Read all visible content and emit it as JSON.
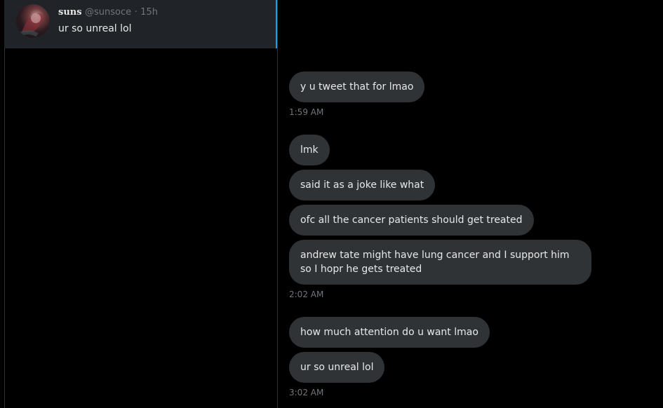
{
  "conversation": {
    "name": "suns",
    "handle": "@sunsoce",
    "separator": "·",
    "time": "15h",
    "preview": "ur so unreal lol"
  },
  "messages": [
    {
      "text": "y u tweet that for lmao"
    },
    {
      "text": "lmk"
    },
    {
      "text": "said it as a joke like what"
    },
    {
      "text": "ofc all the cancer patients should get treated"
    },
    {
      "text": "andrew tate might have lung cancer and I support him so I hopr he gets treated"
    },
    {
      "text": "how much attention do u want lmao"
    },
    {
      "text": "ur so unreal lol"
    }
  ],
  "timestamps": [
    "1:59 AM",
    "2:02 AM",
    "3:02 AM"
  ],
  "colors": {
    "background": "#000000",
    "selected_conversation": "#202327",
    "bubble": "#2f3336",
    "accent": "#1d9bf0",
    "muted_text": "#71767b",
    "text": "#e7e9ea"
  }
}
